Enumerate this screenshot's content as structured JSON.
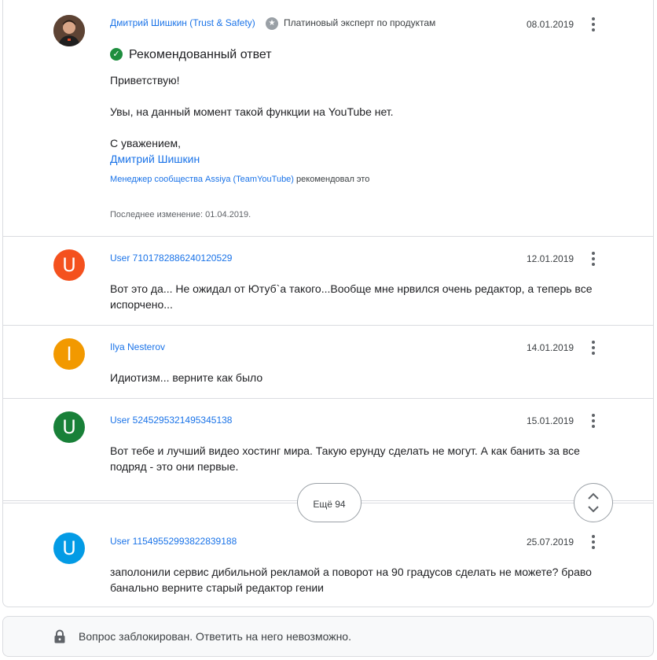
{
  "posts": [
    {
      "author": "Дмитрий Шишкин (Trust & Safety)",
      "badge": "Платиновый эксперт по продуктам",
      "date": "08.01.2019",
      "recommended_label": "Рекомендованный ответ",
      "greeting": "Приветствую!",
      "text": "Увы, на данный момент такой функции на YouTube нет.",
      "regards": "С уважением,",
      "signature": "Дмитрий Шишкин",
      "recommended_by": "Менеджер сообщества Assiya (TeamYouTube)",
      "recommended_suffix": "рекомендовал это",
      "last_edited": "Последнее изменение: 01.04.2019."
    },
    {
      "author": "User 7101782886240120529",
      "avatar_letter": "U",
      "avatar_color": "#f4511e",
      "date": "12.01.2019",
      "text": "Вот это да... Не ожидал от Ютуб`а такого...Вообще мне нрвился очень редактор, а теперь все испорчено..."
    },
    {
      "author": "Ilya Nesterov",
      "avatar_letter": "I",
      "avatar_color": "#f29900",
      "date": "14.01.2019",
      "text": "Идиотизм... верните как было"
    },
    {
      "author": "User 5245295321495345138",
      "avatar_letter": "U",
      "avatar_color": "#188038",
      "date": "15.01.2019",
      "text": "Вот тебе и лучший видео хостинг мира. Такую ерунду сделать не могут. А как банить за все подряд - это они первые."
    },
    {
      "author": "User 11549552993822839188",
      "avatar_letter": "U",
      "avatar_color": "#039be5",
      "date": "25.07.2019",
      "text": "заполонили сервис дибильной рекламой а поворот на 90 градусов сделать не можете? браво банально верните старый редактор гении"
    }
  ],
  "more": {
    "label": "Ещё 94"
  },
  "locked": {
    "text": "Вопрос заблокирован. Ответить на него невозможно."
  },
  "icons": {
    "badge": "star-badge-icon",
    "recommended": "check-circle-icon",
    "menu": "more-vert-icon",
    "expand": "unfold-icon",
    "lock": "lock-icon"
  },
  "colors": {
    "link": "#1a73e8",
    "recommended": "#1e8e3e"
  }
}
